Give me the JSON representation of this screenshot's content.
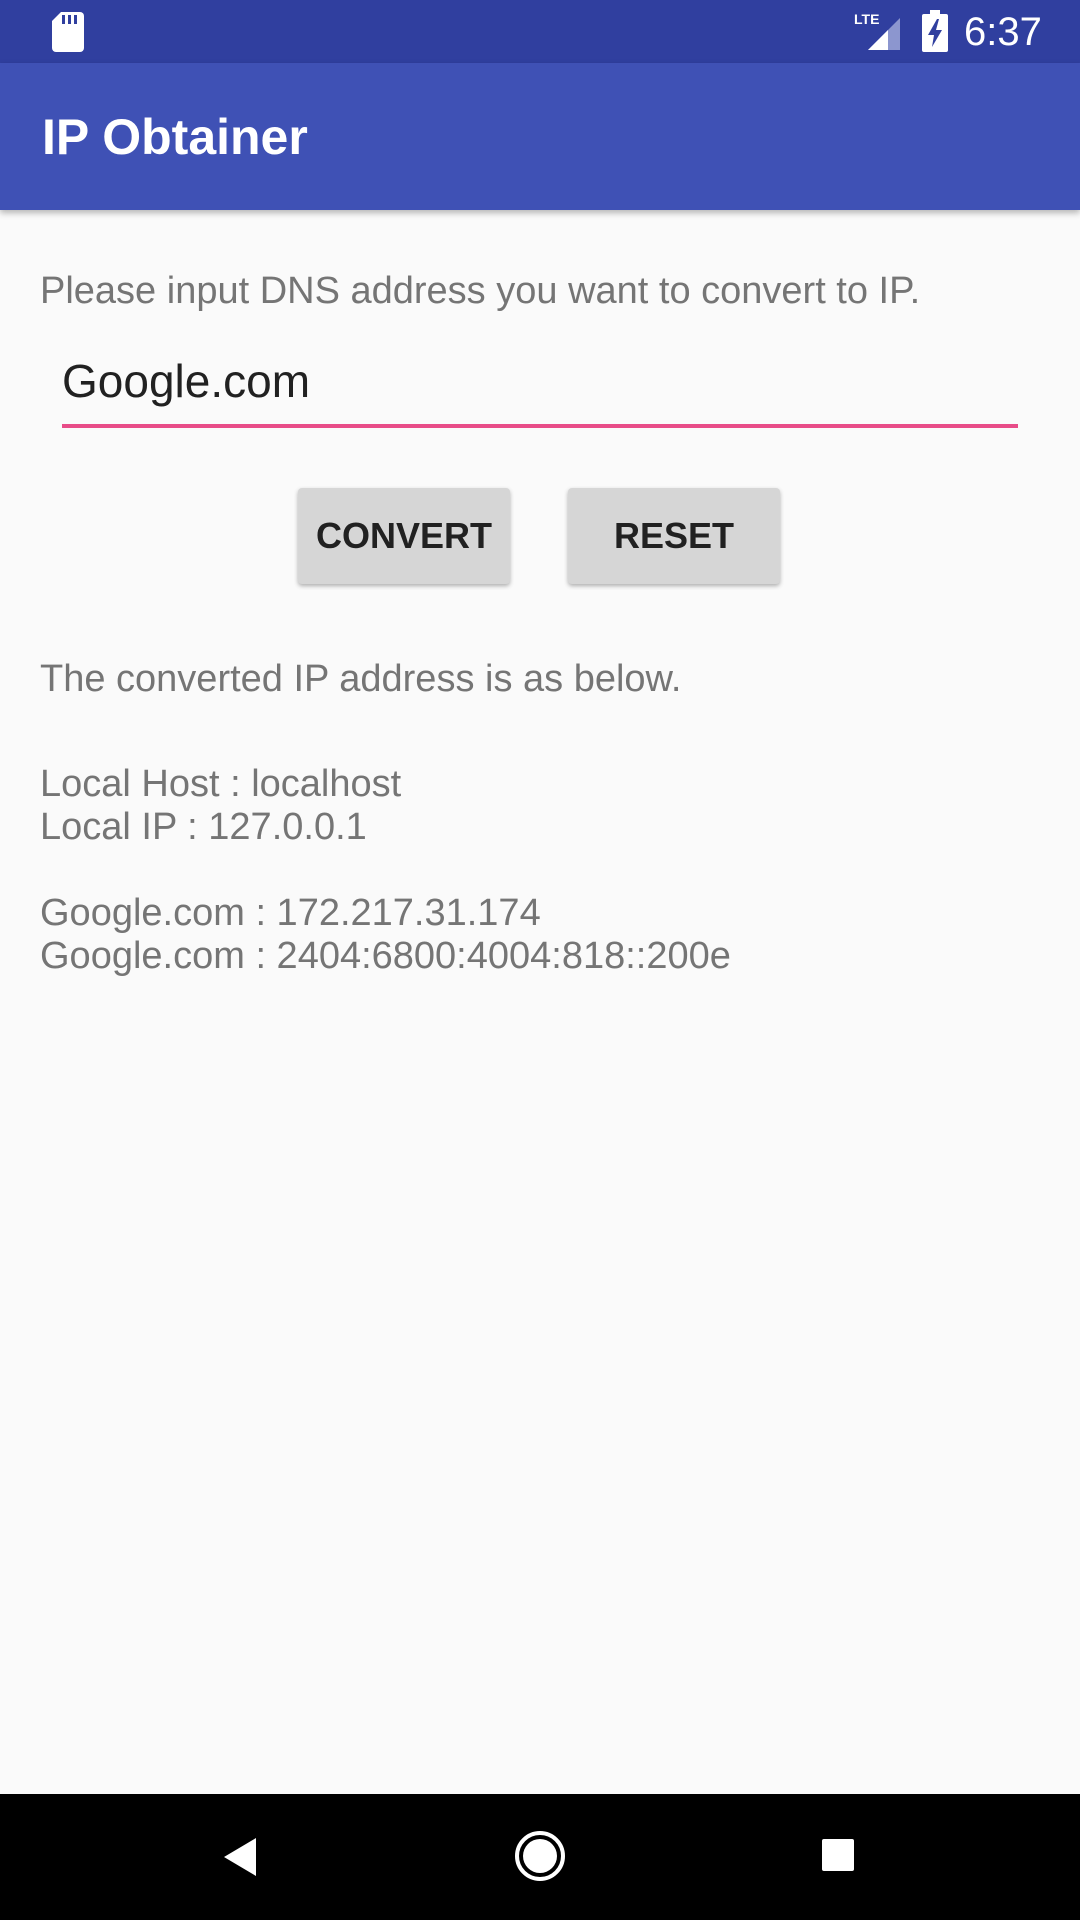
{
  "status_bar": {
    "time": "6:37",
    "network_label": "LTE",
    "icons": [
      "sd-card-icon",
      "lte-signal-icon",
      "battery-charging-icon"
    ]
  },
  "app_bar": {
    "title": "IP Obtainer"
  },
  "form": {
    "prompt": "Please input DNS address you want to convert to IP.",
    "dns_value": "Google.com",
    "accent_color": "#e84c88"
  },
  "buttons": {
    "convert_label": "CONVERT",
    "reset_label": "RESET"
  },
  "results": {
    "heading": "The converted IP address is as below.",
    "local_host": "Local Host : localhost",
    "local_ip": "Local IP : 127.0.0.1",
    "ipv4": "Google.com : 172.217.31.174",
    "ipv6": "Google.com : 2404:6800:4004:818::200e"
  },
  "nav_bar": {
    "icons": [
      "back-icon",
      "home-icon",
      "recents-icon"
    ]
  },
  "colors": {
    "status_bar": "#303f9f",
    "app_bar": "#3f51b5",
    "background": "#fafafa",
    "button": "#d6d6d6"
  }
}
